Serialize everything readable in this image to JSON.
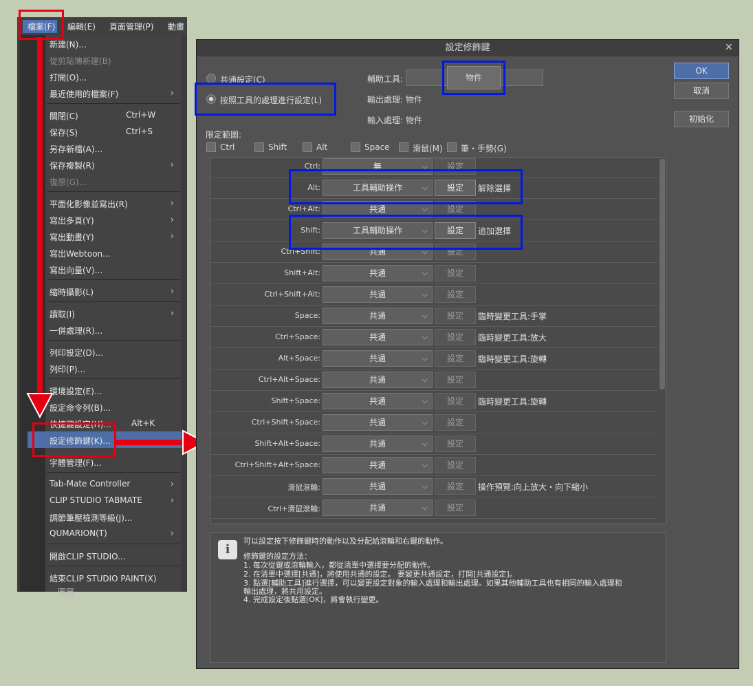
{
  "menubar": {
    "items": [
      "檔案(F)",
      "編輯(E)",
      "頁面管理(P)",
      "動畫"
    ]
  },
  "file_menu": {
    "items": [
      {
        "label": "新建(N)...",
        "shortcut": "",
        "submenu": false,
        "disabled": false
      },
      {
        "label": "從剪貼簿新建(B)",
        "shortcut": "",
        "submenu": false,
        "disabled": true
      },
      {
        "label": "打開(O)...",
        "shortcut": "",
        "submenu": false,
        "disabled": false
      },
      {
        "label": "最近使用的檔案(F)",
        "shortcut": "",
        "submenu": true,
        "disabled": false
      },
      {
        "label": "關閉(C)",
        "shortcut": "Ctrl+W",
        "submenu": false,
        "disabled": false
      },
      {
        "label": "保存(S)",
        "shortcut": "Ctrl+S",
        "submenu": false,
        "disabled": false
      },
      {
        "label": "另存新檔(A)...",
        "shortcut": "",
        "submenu": false,
        "disabled": false
      },
      {
        "label": "保存複製(R)",
        "shortcut": "",
        "submenu": true,
        "disabled": false
      },
      {
        "label": "復原(G)...",
        "shortcut": "",
        "submenu": false,
        "disabled": true
      },
      {
        "label": "平面化影像並寫出(R)",
        "shortcut": "",
        "submenu": true,
        "disabled": false
      },
      {
        "label": "寫出多頁(Y)",
        "shortcut": "",
        "submenu": true,
        "disabled": false
      },
      {
        "label": "寫出動畫(Y)",
        "shortcut": "",
        "submenu": true,
        "disabled": false
      },
      {
        "label": "寫出Webtoon...",
        "shortcut": "",
        "submenu": false,
        "disabled": false
      },
      {
        "label": "寫出向量(V)...",
        "shortcut": "",
        "submenu": false,
        "disabled": false
      },
      {
        "label": "縮時攝影(L)",
        "shortcut": "",
        "submenu": true,
        "disabled": false
      },
      {
        "label": "讀取(I)",
        "shortcut": "",
        "submenu": true,
        "disabled": false
      },
      {
        "label": "一併處理(R)...",
        "shortcut": "",
        "submenu": false,
        "disabled": false
      },
      {
        "label": "列印設定(D)...",
        "shortcut": "",
        "submenu": false,
        "disabled": false
      },
      {
        "label": "列印(P)...",
        "shortcut": "",
        "submenu": false,
        "disabled": false
      },
      {
        "label": "環境設定(E)...",
        "shortcut": "",
        "submenu": false,
        "disabled": false
      },
      {
        "label": "設定命令列(B)...",
        "shortcut": "",
        "submenu": false,
        "disabled": false
      },
      {
        "label": "快捷鍵設定(H)...",
        "shortcut": "Alt+K",
        "submenu": false,
        "disabled": false
      },
      {
        "label": "設定修飾鍵(K)...",
        "shortcut": "",
        "submenu": false,
        "disabled": false
      },
      {
        "label": "字體管理(F)...",
        "shortcut": "",
        "submenu": false,
        "disabled": false
      },
      {
        "label": "Tab-Mate Controller",
        "shortcut": "",
        "submenu": true,
        "disabled": false
      },
      {
        "label": "CLIP STUDIO TABMATE",
        "shortcut": "",
        "submenu": true,
        "disabled": false
      },
      {
        "label": "調節筆壓檢測等級(J)...",
        "shortcut": "",
        "submenu": false,
        "disabled": false
      },
      {
        "label": "QUMARION(T)",
        "shortcut": "",
        "submenu": true,
        "disabled": false
      },
      {
        "label": "開啟CLIP STUDIO...",
        "shortcut": "",
        "submenu": false,
        "disabled": false
      },
      {
        "label": "結束CLIP STUDIO PAINT(X)",
        "shortcut": "",
        "submenu": false,
        "disabled": false
      },
      {
        "label": "圖層",
        "shortcut": "",
        "submenu": false,
        "disabled": false
      }
    ]
  },
  "dialog": {
    "title": "設定修飾鍵",
    "radio_common": "共通設定(C)",
    "radio_per_tool": "按照工具的處理進行設定(L)",
    "tool_label": "輔助工具:",
    "tool_value": "物件",
    "output_label": "輸出處理: 物件",
    "input_label": "輸入處理: 物件",
    "scope_label": "限定範圍:",
    "scope_checks": [
      "Ctrl",
      "Shift",
      "Alt",
      "Space",
      "滑鼠(M)",
      "筆・手勢(G)"
    ],
    "buttons": {
      "ok": "OK",
      "cancel": "取消",
      "reset": "初始化"
    },
    "rows": [
      {
        "key": "Ctrl:",
        "value": "無",
        "set": "設定",
        "desc": "",
        "active": false
      },
      {
        "key": "Alt:",
        "value": "工具輔助操作",
        "set": "設定",
        "desc": "解除選擇",
        "active": true
      },
      {
        "key": "Ctrl+Alt:",
        "value": "共通",
        "set": "設定",
        "desc": "",
        "active": false
      },
      {
        "key": "Shift:",
        "value": "工具輔助操作",
        "set": "設定",
        "desc": "追加選擇",
        "active": true
      },
      {
        "key": "Ctrl+Shift:",
        "value": "共通",
        "set": "設定",
        "desc": "",
        "active": false
      },
      {
        "key": "Shift+Alt:",
        "value": "共通",
        "set": "設定",
        "desc": "",
        "active": false
      },
      {
        "key": "Ctrl+Shift+Alt:",
        "value": "共通",
        "set": "設定",
        "desc": "",
        "active": false
      },
      {
        "key": "Space:",
        "value": "共通",
        "set": "設定",
        "desc": "臨時變更工具:手掌",
        "active": false
      },
      {
        "key": "Ctrl+Space:",
        "value": "共通",
        "set": "設定",
        "desc": "臨時變更工具:放大",
        "active": false
      },
      {
        "key": "Alt+Space:",
        "value": "共通",
        "set": "設定",
        "desc": "臨時變更工具:旋轉",
        "active": false
      },
      {
        "key": "Ctrl+Alt+Space:",
        "value": "共通",
        "set": "設定",
        "desc": "",
        "active": false
      },
      {
        "key": "Shift+Space:",
        "value": "共通",
        "set": "設定",
        "desc": "臨時變更工具:旋轉",
        "active": false
      },
      {
        "key": "Ctrl+Shift+Space:",
        "value": "共通",
        "set": "設定",
        "desc": "",
        "active": false
      },
      {
        "key": "Shift+Alt+Space:",
        "value": "共通",
        "set": "設定",
        "desc": "",
        "active": false
      },
      {
        "key": "Ctrl+Shift+Alt+Space:",
        "value": "共通",
        "set": "設定",
        "desc": "",
        "active": false
      },
      {
        "key": "滑鼠滾輪:",
        "value": "共通",
        "set": "設定",
        "desc": "操作預覽:向上放大・向下縮小",
        "active": false
      },
      {
        "key": "Ctrl+滑鼠滾輪:",
        "value": "共通",
        "set": "設定",
        "desc": "",
        "active": false
      }
    ],
    "info": {
      "intro": "可以設定按下修飾鍵時的動作以及分配給滾輪和右鍵的動作。",
      "heading": "修飾鍵的設定方法：",
      "steps": [
        "1. 每次從鍵或滾輪輸入，都從清單中選擇要分配的動作。",
        "2. 在清單中選擇[共通]，將使用共通的設定。 要變更共通設定，打開[共通設定]。",
        "3. 點選[輔助工具]進行選擇，可以變更設定對象的輸入處理和輸出處理。如果其他輔助工具也有相同的輸入處理和",
        "輸出處理，將共用設定。",
        "4. 完成設定後點選[OK]，將會執行變更。"
      ]
    }
  },
  "colors": {
    "highlight_red": "#e60012",
    "highlight_blue": "#0019e6",
    "selection_blue": "#4e6ea8"
  }
}
